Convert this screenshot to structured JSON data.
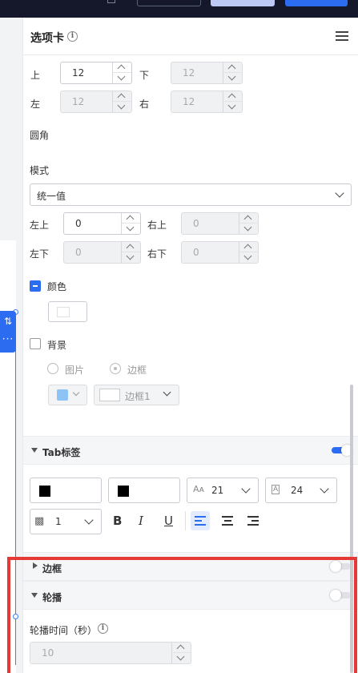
{
  "panel": {
    "title": "选项卡"
  },
  "padding": {
    "top_label": "上",
    "top_value": "12",
    "bottom_label": "下",
    "bottom_value": "12",
    "left_label": "左",
    "left_value": "12",
    "right_label": "右",
    "right_value": "12"
  },
  "radius": {
    "title": "圆角",
    "mode_label": "模式",
    "mode_value": "统一值",
    "top_left_label": "左上",
    "top_left_value": "0",
    "top_right_label": "右上",
    "top_right_value": "0",
    "bottom_left_label": "左下",
    "bottom_left_value": "0",
    "bottom_right_label": "右下",
    "bottom_right_value": "0"
  },
  "color": {
    "label": "颜色",
    "checked": true
  },
  "background": {
    "label": "背景",
    "checked": false,
    "option_image": "图片",
    "option_border": "边框",
    "border_select": "边框1"
  },
  "tab_label_section": {
    "title": "Tab标签",
    "enabled": true,
    "font_size": "21",
    "line_height": "24",
    "letter_spacing": "1",
    "text_color": "#000000",
    "bg_color": "#000000"
  },
  "border_section": {
    "title": "边框",
    "enabled": false
  },
  "carousel_section": {
    "title": "轮播",
    "enabled": false,
    "interval_label": "轮播时间（秒）",
    "interval_value": "10"
  },
  "colors": {
    "accent": "#2b6cf0",
    "highlight": "#e53935",
    "swatch": "#8ec3f5"
  }
}
